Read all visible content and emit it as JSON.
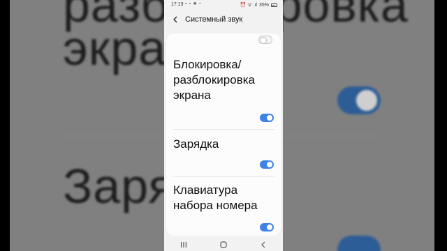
{
  "background": {
    "line1": "разблокировка",
    "line2": "экрана",
    "line3": "Зарядка"
  },
  "status_bar": {
    "time": "17:19",
    "notifications": "▪ ▪ ✱ •",
    "signal_icons": "⏰ ᯤ .ıl",
    "battery": "35%"
  },
  "header": {
    "back_icon": "chevron-left-icon",
    "title": "Системный звук"
  },
  "settings": {
    "partial_toggle": {
      "state": "off"
    },
    "items": [
      {
        "label": "Блокировка/\nразблокировка\nэкрана",
        "toggle": "on"
      },
      {
        "label": "Зарядка",
        "toggle": "on"
      },
      {
        "label": "Клавиатура\nнабора номера",
        "toggle": "on"
      }
    ]
  },
  "nav_bar": {
    "recents_icon": "recents-icon",
    "home_icon": "home-icon",
    "back_icon": "back-nav-icon"
  },
  "colors": {
    "accent": "#3e82e6",
    "page_bg": "#f2f2f2",
    "card_bg": "#fcfcfc"
  }
}
